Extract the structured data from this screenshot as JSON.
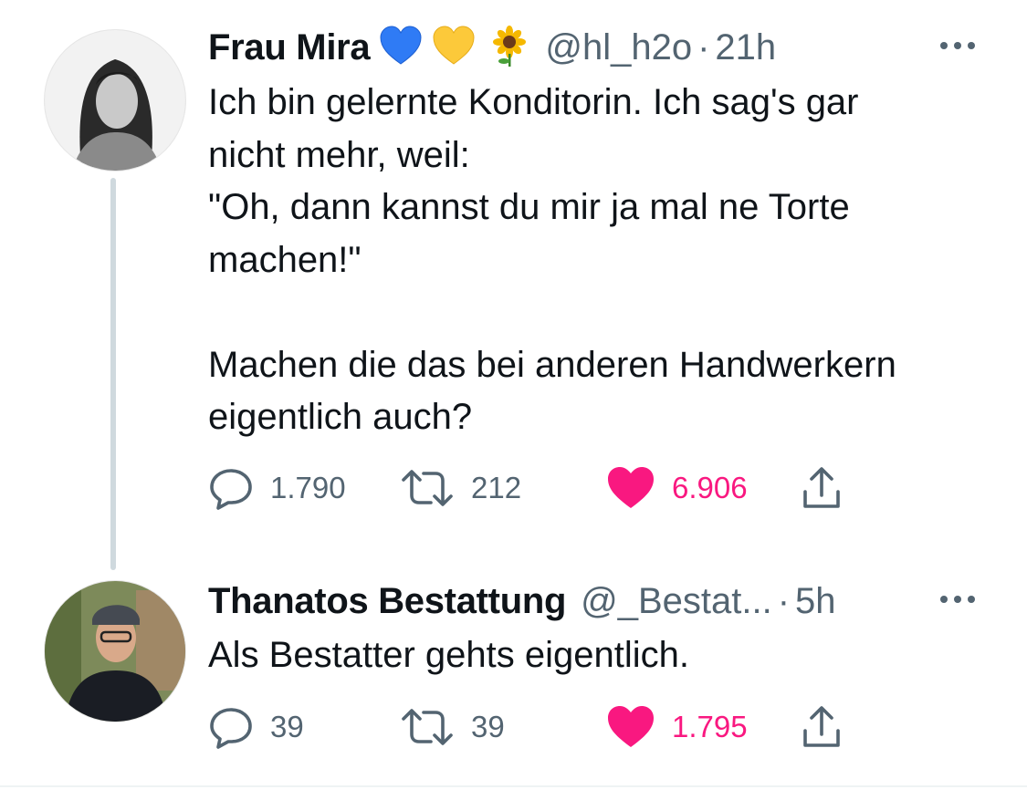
{
  "tweets": [
    {
      "name": "Frau Mira",
      "handle": "@hl_h2o",
      "separator": "·",
      "time": "21h",
      "text": "Ich bin gelernte Konditorin. Ich sag's gar\nnicht mehr, weil:\n\"Oh, dann kannst du mir ja mal ne Torte\nmachen!\"\n\nMachen die das bei anderen Handwerkern\neigentlich auch?",
      "replies": "1.790",
      "retweets": "212",
      "likes": "6.906",
      "liked": true
    },
    {
      "name": "Thanatos Bestattung",
      "handle": "@_Bestat...",
      "separator": "·",
      "time": "5h",
      "text": "Als Bestatter gehts eigentlich.",
      "replies": "39",
      "retweets": "39",
      "likes": "1.795",
      "liked": true
    }
  ],
  "icons": {
    "name_badges": [
      "blue-heart-icon",
      "yellow-heart-icon",
      "sunflower-icon"
    ],
    "reply": "reply-icon",
    "retweet": "retweet-icon",
    "like": "heart-icon",
    "share": "share-icon",
    "more": "more-icon"
  },
  "colors": {
    "like_active": "#f91880",
    "secondary_text": "#536471",
    "thread_line": "#cfd9de"
  }
}
